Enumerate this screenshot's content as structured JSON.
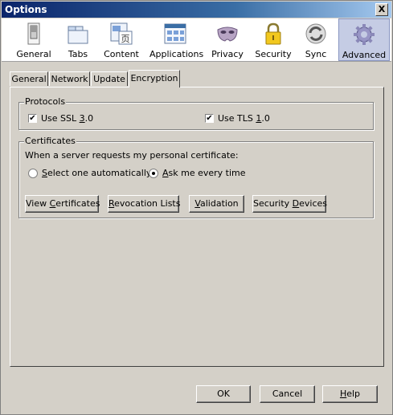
{
  "window": {
    "title": "Options",
    "close_label": "X"
  },
  "toolbar": {
    "items": [
      {
        "label": "General",
        "icon": "general-switch-icon"
      },
      {
        "label": "Tabs",
        "icon": "tabs-icon"
      },
      {
        "label": "Content",
        "icon": "content-icon"
      },
      {
        "label": "Applications",
        "icon": "applications-icon"
      },
      {
        "label": "Privacy",
        "icon": "privacy-mask-icon"
      },
      {
        "label": "Security",
        "icon": "security-padlock-icon"
      },
      {
        "label": "Sync",
        "icon": "sync-icon"
      },
      {
        "label": "Advanced",
        "icon": "advanced-gear-icon"
      }
    ],
    "selected": "Advanced"
  },
  "tabs": [
    {
      "label": "General"
    },
    {
      "label": "Network"
    },
    {
      "label": "Update"
    },
    {
      "label": "Encryption"
    }
  ],
  "active_tab": "Encryption",
  "protocols": {
    "label": "Protocols",
    "ssl": {
      "label_pre": "Use SSL ",
      "label_ul": "3",
      "label_post": ".0",
      "checked": true
    },
    "tls": {
      "label_pre": "Use TLS ",
      "label_ul": "1",
      "label_post": ".0",
      "checked": true
    }
  },
  "certificates": {
    "label": "Certificates",
    "prompt": "When a server requests my personal certificate:",
    "auto": {
      "label_ul": "S",
      "label_post": "elect one automatically",
      "selected": false
    },
    "ask": {
      "label_ul": "A",
      "label_post": "sk me every time",
      "selected": true
    },
    "buttons": {
      "view": {
        "pre": "View ",
        "ul": "C",
        "post": "ertificates"
      },
      "revocation": {
        "pre": "",
        "ul": "R",
        "post": "evocation Lists"
      },
      "validation": {
        "pre": "",
        "ul": "V",
        "post": "alidation"
      },
      "devices": {
        "pre": "Security ",
        "ul": "D",
        "post": "evices"
      }
    }
  },
  "footer": {
    "ok": "OK",
    "cancel": "Cancel",
    "help": {
      "ul": "H",
      "post": "elp"
    }
  }
}
